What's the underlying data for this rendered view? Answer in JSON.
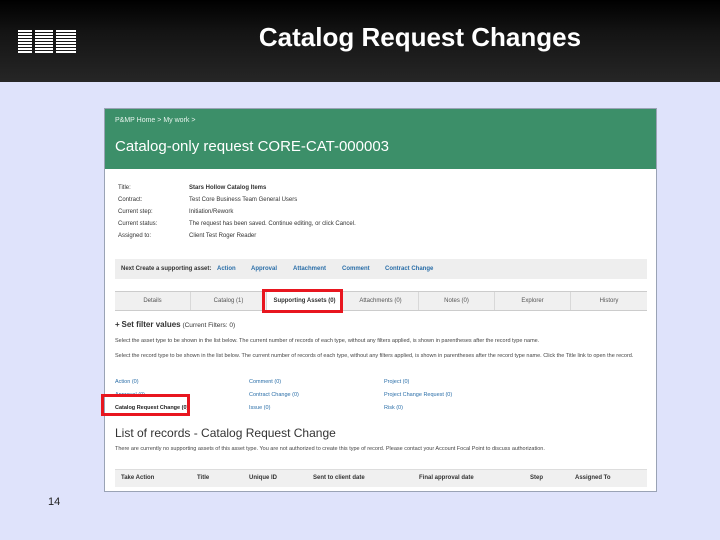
{
  "slide": {
    "title": "Catalog Request Changes",
    "page_number": "14",
    "logo_text": "IBM"
  },
  "app": {
    "breadcrumb": [
      "P&MP Home",
      ">",
      "My work",
      ">"
    ],
    "request_title": "Catalog-only request CORE-CAT-000003",
    "info": [
      {
        "label": "Title:",
        "value": "Stars Hollow Catalog Items"
      },
      {
        "label": "Contract:",
        "value": "Test   Core Business Team   General Users"
      },
      {
        "label": "Current step:",
        "value": "Initiation/Rework"
      },
      {
        "label": "Current status:",
        "value": "The request has been saved. Continue editing, or click Cancel."
      },
      {
        "label": "Assigned to:",
        "value": "Client Test Roger Reader"
      }
    ],
    "create_bar": {
      "label": "Next Create a supporting asset:",
      "links": [
        "Action",
        "Approval",
        "Attachment",
        "Comment",
        "Contract Change"
      ]
    },
    "tabs": [
      "Details",
      "Catalog (1)",
      "Supporting Assets (0)",
      "Attachments (0)",
      "Notes (0)",
      "Explorer",
      "History"
    ],
    "active_tab": "Supporting Assets (0)",
    "set_filter": {
      "label": "Set filter values",
      "suffix": "(Current Filters: 0)"
    },
    "desc_1": "Select the asset type to be shown in the list below. The current number of records of each type, without any filters applied, is shown in parentheses after the record type name.",
    "desc_2": "Select the record type to be shown in the list below. The current number of records of each type, without any filters applied, is shown in parentheses after the record type name. Click the Title link to open the record.",
    "record_types": {
      "col1": [
        "Action (0)",
        "Approval (0)",
        "Catalog Request Change (0)"
      ],
      "col2": [
        "Comment (0)",
        "Contract Change (0)",
        "Issue (0)"
      ],
      "col3": [
        "Project (0)",
        "Project Change Request (0)",
        "Risk (0)"
      ]
    },
    "selected_record_type": "Catalog Request Change (0)",
    "list_title": "List of records - Catalog Request Change",
    "no_records_text": "There are currently no supporting assets of this asset type. You are not authorized to create this type of record. Please contact your Account Focal Point to discuss authorization.",
    "columns": [
      "Take Action",
      "Title",
      "Unique ID",
      "Sent to client date",
      "Final approval date",
      "Step",
      "Assigned To"
    ]
  },
  "colors": {
    "banner": "#3c8f69",
    "slide_bg": "#dfe3fb",
    "highlight": "#e8161f",
    "link": "#2a6ea8"
  }
}
